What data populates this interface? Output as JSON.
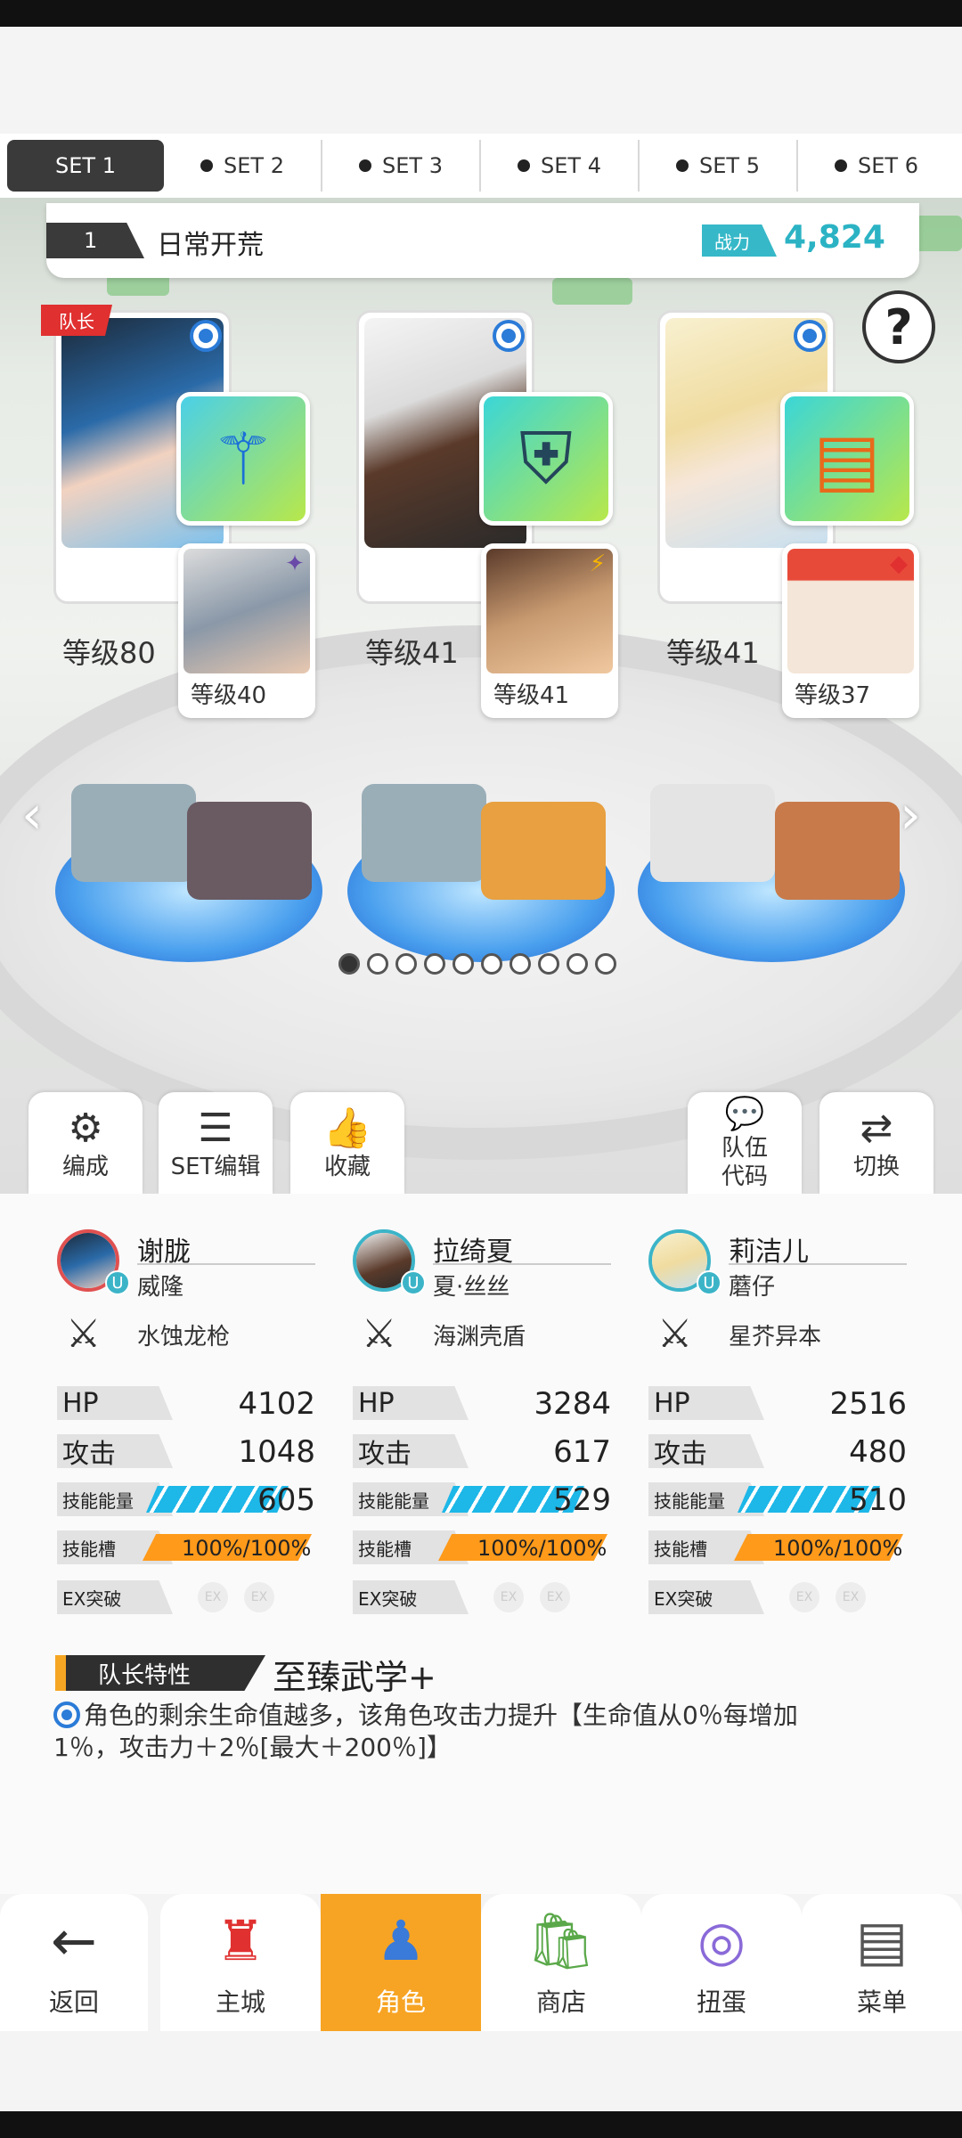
{
  "set_tabs": [
    {
      "label": "SET 1",
      "active": true
    },
    {
      "label": "SET 2",
      "active": false
    },
    {
      "label": "SET 3",
      "active": false
    },
    {
      "label": "SET 4",
      "active": false
    },
    {
      "label": "SET 5",
      "active": false
    },
    {
      "label": "SET 6",
      "active": false
    }
  ],
  "team": {
    "number": "1",
    "name": "日常开荒",
    "power_label": "战力",
    "power_value": "4,824"
  },
  "leader_tag": "队长",
  "help_icon": "question-icon",
  "characters": [
    {
      "level": "等级80",
      "sub_level": "等级40",
      "equip_icon": "trident-icon",
      "sub_badge": "✦"
    },
    {
      "level": "等级41",
      "sub_level": "等级41",
      "equip_icon": "shield-icon",
      "sub_badge": "⚡"
    },
    {
      "level": "等级41",
      "sub_level": "等级37",
      "equip_icon": "book-icon",
      "sub_badge": "◆"
    }
  ],
  "page_dots": {
    "count": 10,
    "active_index": 0
  },
  "actions": {
    "formation": "编成",
    "set_edit": "SET编辑",
    "favorite": "收藏",
    "team_code_line1": "队伍",
    "team_code_line2": "代码",
    "switch": "切换"
  },
  "stats": [
    {
      "name": "谢胧",
      "sub": "威隆",
      "weapon": "水蚀龙枪",
      "hp_label": "HP",
      "hp": "4102",
      "atk_label": "攻击",
      "atk": "1048",
      "energy_label": "技能能量",
      "energy": "605",
      "slot_label": "技能槽",
      "slot": "100%/100%",
      "ex_label": "EX突破",
      "ex_a": "EX",
      "ex_b": "EX"
    },
    {
      "name": "拉绮夏",
      "sub": "夏·丝丝",
      "weapon": "海渊壳盾",
      "hp_label": "HP",
      "hp": "3284",
      "atk_label": "攻击",
      "atk": "617",
      "energy_label": "技能能量",
      "energy": "529",
      "slot_label": "技能槽",
      "slot": "100%/100%",
      "ex_label": "EX突破",
      "ex_a": "EX",
      "ex_b": "EX"
    },
    {
      "name": "莉洁儿",
      "sub": "蘑仔",
      "weapon": "星芥异本",
      "hp_label": "HP",
      "hp": "2516",
      "atk_label": "攻击",
      "atk": "480",
      "energy_label": "技能能量",
      "energy": "510",
      "slot_label": "技能槽",
      "slot": "100%/100%",
      "ex_label": "EX突破",
      "ex_a": "EX",
      "ex_b": "EX"
    }
  ],
  "leader_skill": {
    "label": "队长特性",
    "name": "至臻武学+",
    "desc": "角色的剩余生命值越多，该角色攻击力提升【生命值从0％每增加1％，攻击力＋2％[最大＋200％]】"
  },
  "nav": [
    {
      "label": "返回",
      "icon": "back-arrow-icon",
      "active": false
    },
    {
      "label": "主城",
      "icon": "castle-icon",
      "active": false
    },
    {
      "label": "角色",
      "icon": "character-icon",
      "active": true
    },
    {
      "label": "商店",
      "icon": "shop-icon",
      "active": false
    },
    {
      "label": "扭蛋",
      "icon": "gacha-icon",
      "active": false
    },
    {
      "label": "菜单",
      "icon": "menu-icon",
      "active": false
    }
  ],
  "colors": {
    "accent_teal": "#2bb3c4",
    "nav_active": "#f7a424",
    "energy_bar": "#1db7e8",
    "slot_bar": "#ff9a1a",
    "leader_red": "#e03030"
  }
}
